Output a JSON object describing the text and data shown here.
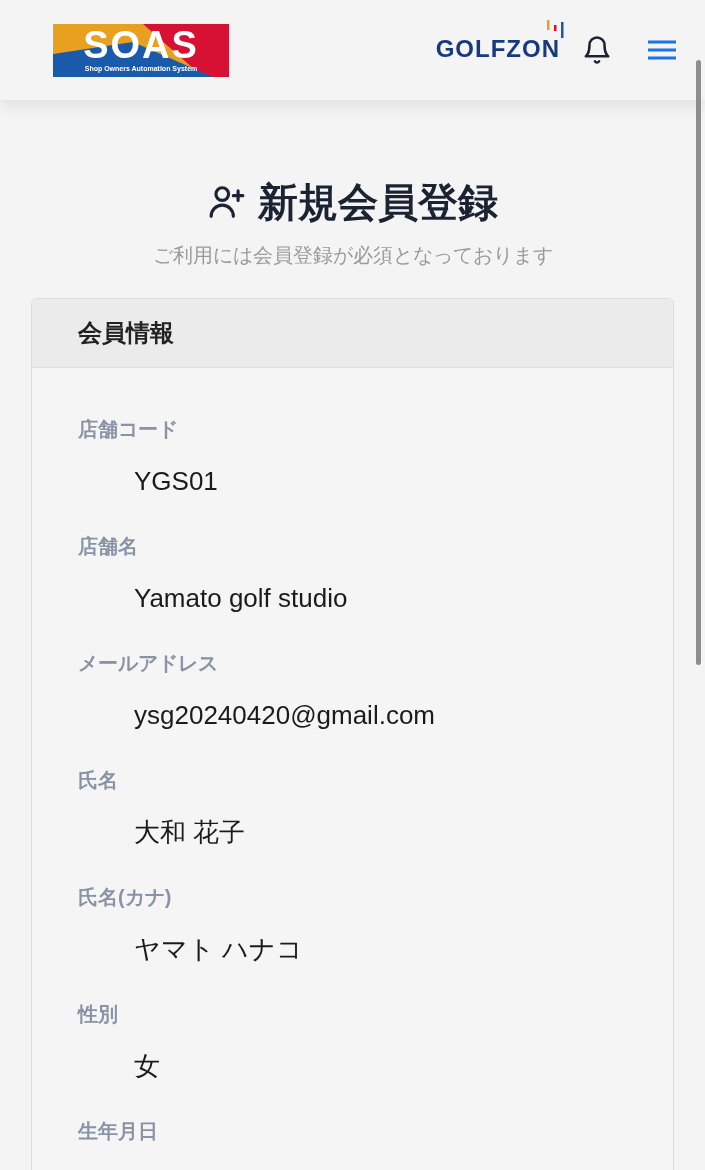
{
  "header": {
    "logo": {
      "title": "SOAS",
      "subtitle": "Shop Owners Automation System"
    },
    "brand": "GOLFZON"
  },
  "page": {
    "title": "新規会員登録",
    "subtitle": "ご利用には会員登録が必須となっております"
  },
  "card": {
    "title": "会員情報",
    "fields": [
      {
        "label": "店舗コード",
        "value": "YGS01"
      },
      {
        "label": "店舗名",
        "value": "Yamato golf studio"
      },
      {
        "label": "メールアドレス",
        "value": "ysg20240420@gmail.com"
      },
      {
        "label": "氏名",
        "value": "大和 花子"
      },
      {
        "label": "氏名(カナ)",
        "value": "ヤマト ハナコ"
      },
      {
        "label": "性別",
        "value": "女"
      },
      {
        "label": "生年月日"
      }
    ]
  }
}
